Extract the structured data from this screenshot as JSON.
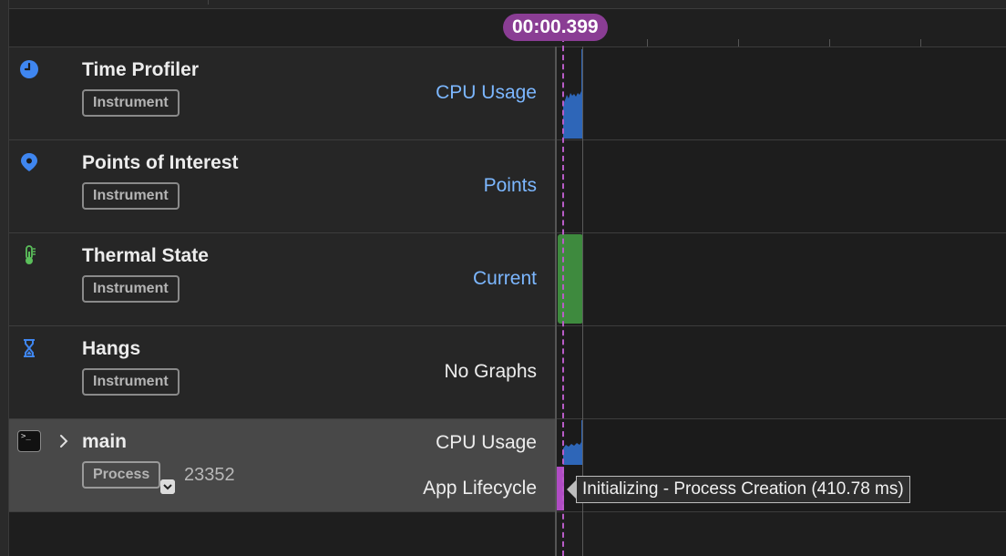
{
  "cursor_time": "00:00.399",
  "tracks": [
    {
      "title": "Time Profiler",
      "badge": "Instrument",
      "graph": "CPU Usage",
      "icon": "clock-icon"
    },
    {
      "title": "Points of Interest",
      "badge": "Instrument",
      "graph": "Points",
      "icon": "location-pin-icon"
    },
    {
      "title": "Thermal State",
      "badge": "Instrument",
      "graph": "Current",
      "icon": "thermometer-icon"
    },
    {
      "title": "Hangs",
      "badge": "Instrument",
      "graph": "No Graphs",
      "icon": "hourglass-icon"
    }
  ],
  "process": {
    "title": "main",
    "badge": "Process",
    "pid": "23352",
    "graph1": "CPU Usage",
    "graph2": "App Lifecycle",
    "icon": "terminal-icon",
    "tooltip": "Initializing - Process Creation (410.78 ms)"
  },
  "colors": {
    "accent_blue": "#7cb7ff",
    "cpu_bar": "#2e66b8",
    "thermal_green": "#3e8a3e",
    "cursor_purple": "#8a3d94"
  }
}
